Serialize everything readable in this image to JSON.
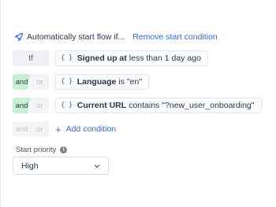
{
  "header": {
    "title": "Automatically start flow if...",
    "remove_link": "Remove start condition",
    "icon": "rocket-icon"
  },
  "conditions": [
    {
      "connector": "If",
      "property": "Signed up at",
      "operator": "less than",
      "value": "1 day ago"
    },
    {
      "connector_and": "and",
      "connector_or": "or",
      "property": "Language",
      "operator": "is",
      "value": "\"en\""
    },
    {
      "connector_and": "and",
      "connector_or": "or",
      "property": "Current URL",
      "operator": "contains",
      "value": "\"?new_user_onboarding\""
    }
  ],
  "add_row": {
    "connector_and": "and",
    "connector_or": "or",
    "label": "Add condition"
  },
  "priority": {
    "label": "Start priority",
    "selected": "High"
  },
  "colors": {
    "accent": "#2f6bd8",
    "and_active": "#c9f0d6"
  }
}
